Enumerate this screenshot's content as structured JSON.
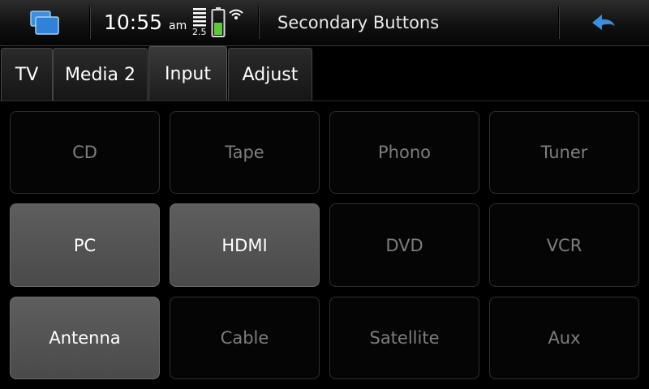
{
  "statusbar": {
    "clock_time": "10:55",
    "clock_ampm": "am",
    "signal_label": "2.5",
    "title": "Secondary Buttons",
    "icons": [
      "task-switcher-icon",
      "signal-strength-icon",
      "battery-icon",
      "wifi-icon",
      "back-arrow-icon"
    ],
    "battery_level": 0.5,
    "accent_color": "#3b8fe0",
    "battery_color": "#5fc83a"
  },
  "tabs": [
    {
      "label": "TV",
      "active": false
    },
    {
      "label": "Media 2",
      "active": false
    },
    {
      "label": "Input",
      "active": true
    },
    {
      "label": "Adjust",
      "active": false
    }
  ],
  "buttons": [
    {
      "label": "CD",
      "active": false
    },
    {
      "label": "Tape",
      "active": false
    },
    {
      "label": "Phono",
      "active": false
    },
    {
      "label": "Tuner",
      "active": false
    },
    {
      "label": "PC",
      "active": true
    },
    {
      "label": "HDMI",
      "active": true
    },
    {
      "label": "DVD",
      "active": false
    },
    {
      "label": "VCR",
      "active": false
    },
    {
      "label": "Antenna",
      "active": true
    },
    {
      "label": "Cable",
      "active": false
    },
    {
      "label": "Satellite",
      "active": false
    },
    {
      "label": "Aux",
      "active": false
    }
  ]
}
